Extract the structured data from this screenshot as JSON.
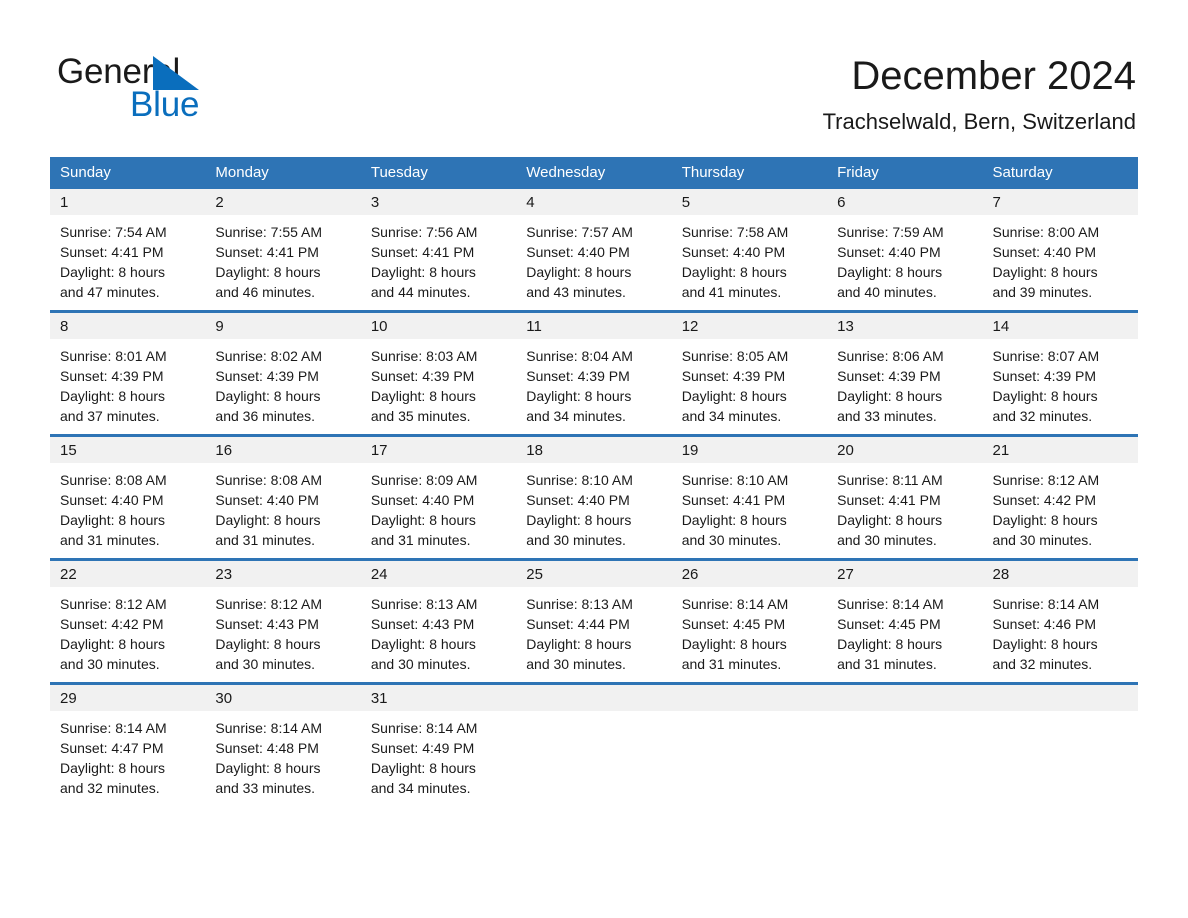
{
  "brand": {
    "word1": "General",
    "word2": "Blue",
    "triangle_color": "#0a6ebd",
    "text_color": "#1a1a1a",
    "icon": "triangle-logo-icon"
  },
  "header": {
    "month_title": "December 2024",
    "location": "Trachselwald, Bern, Switzerland"
  },
  "theme": {
    "header_blue": "#2e74b5",
    "day_band_gray": "#f1f1f1",
    "text": "#1a1a1a",
    "page_background": "#ffffff"
  },
  "weekdays": [
    "Sunday",
    "Monday",
    "Tuesday",
    "Wednesday",
    "Thursday",
    "Friday",
    "Saturday"
  ],
  "weeks": [
    [
      {
        "day": "1",
        "sunrise": "Sunrise: 7:54 AM",
        "sunset": "Sunset: 4:41 PM",
        "daylight1": "Daylight: 8 hours",
        "daylight2": "and 47 minutes."
      },
      {
        "day": "2",
        "sunrise": "Sunrise: 7:55 AM",
        "sunset": "Sunset: 4:41 PM",
        "daylight1": "Daylight: 8 hours",
        "daylight2": "and 46 minutes."
      },
      {
        "day": "3",
        "sunrise": "Sunrise: 7:56 AM",
        "sunset": "Sunset: 4:41 PM",
        "daylight1": "Daylight: 8 hours",
        "daylight2": "and 44 minutes."
      },
      {
        "day": "4",
        "sunrise": "Sunrise: 7:57 AM",
        "sunset": "Sunset: 4:40 PM",
        "daylight1": "Daylight: 8 hours",
        "daylight2": "and 43 minutes."
      },
      {
        "day": "5",
        "sunrise": "Sunrise: 7:58 AM",
        "sunset": "Sunset: 4:40 PM",
        "daylight1": "Daylight: 8 hours",
        "daylight2": "and 41 minutes."
      },
      {
        "day": "6",
        "sunrise": "Sunrise: 7:59 AM",
        "sunset": "Sunset: 4:40 PM",
        "daylight1": "Daylight: 8 hours",
        "daylight2": "and 40 minutes."
      },
      {
        "day": "7",
        "sunrise": "Sunrise: 8:00 AM",
        "sunset": "Sunset: 4:40 PM",
        "daylight1": "Daylight: 8 hours",
        "daylight2": "and 39 minutes."
      }
    ],
    [
      {
        "day": "8",
        "sunrise": "Sunrise: 8:01 AM",
        "sunset": "Sunset: 4:39 PM",
        "daylight1": "Daylight: 8 hours",
        "daylight2": "and 37 minutes."
      },
      {
        "day": "9",
        "sunrise": "Sunrise: 8:02 AM",
        "sunset": "Sunset: 4:39 PM",
        "daylight1": "Daylight: 8 hours",
        "daylight2": "and 36 minutes."
      },
      {
        "day": "10",
        "sunrise": "Sunrise: 8:03 AM",
        "sunset": "Sunset: 4:39 PM",
        "daylight1": "Daylight: 8 hours",
        "daylight2": "and 35 minutes."
      },
      {
        "day": "11",
        "sunrise": "Sunrise: 8:04 AM",
        "sunset": "Sunset: 4:39 PM",
        "daylight1": "Daylight: 8 hours",
        "daylight2": "and 34 minutes."
      },
      {
        "day": "12",
        "sunrise": "Sunrise: 8:05 AM",
        "sunset": "Sunset: 4:39 PM",
        "daylight1": "Daylight: 8 hours",
        "daylight2": "and 34 minutes."
      },
      {
        "day": "13",
        "sunrise": "Sunrise: 8:06 AM",
        "sunset": "Sunset: 4:39 PM",
        "daylight1": "Daylight: 8 hours",
        "daylight2": "and 33 minutes."
      },
      {
        "day": "14",
        "sunrise": "Sunrise: 8:07 AM",
        "sunset": "Sunset: 4:39 PM",
        "daylight1": "Daylight: 8 hours",
        "daylight2": "and 32 minutes."
      }
    ],
    [
      {
        "day": "15",
        "sunrise": "Sunrise: 8:08 AM",
        "sunset": "Sunset: 4:40 PM",
        "daylight1": "Daylight: 8 hours",
        "daylight2": "and 31 minutes."
      },
      {
        "day": "16",
        "sunrise": "Sunrise: 8:08 AM",
        "sunset": "Sunset: 4:40 PM",
        "daylight1": "Daylight: 8 hours",
        "daylight2": "and 31 minutes."
      },
      {
        "day": "17",
        "sunrise": "Sunrise: 8:09 AM",
        "sunset": "Sunset: 4:40 PM",
        "daylight1": "Daylight: 8 hours",
        "daylight2": "and 31 minutes."
      },
      {
        "day": "18",
        "sunrise": "Sunrise: 8:10 AM",
        "sunset": "Sunset: 4:40 PM",
        "daylight1": "Daylight: 8 hours",
        "daylight2": "and 30 minutes."
      },
      {
        "day": "19",
        "sunrise": "Sunrise: 8:10 AM",
        "sunset": "Sunset: 4:41 PM",
        "daylight1": "Daylight: 8 hours",
        "daylight2": "and 30 minutes."
      },
      {
        "day": "20",
        "sunrise": "Sunrise: 8:11 AM",
        "sunset": "Sunset: 4:41 PM",
        "daylight1": "Daylight: 8 hours",
        "daylight2": "and 30 minutes."
      },
      {
        "day": "21",
        "sunrise": "Sunrise: 8:12 AM",
        "sunset": "Sunset: 4:42 PM",
        "daylight1": "Daylight: 8 hours",
        "daylight2": "and 30 minutes."
      }
    ],
    [
      {
        "day": "22",
        "sunrise": "Sunrise: 8:12 AM",
        "sunset": "Sunset: 4:42 PM",
        "daylight1": "Daylight: 8 hours",
        "daylight2": "and 30 minutes."
      },
      {
        "day": "23",
        "sunrise": "Sunrise: 8:12 AM",
        "sunset": "Sunset: 4:43 PM",
        "daylight1": "Daylight: 8 hours",
        "daylight2": "and 30 minutes."
      },
      {
        "day": "24",
        "sunrise": "Sunrise: 8:13 AM",
        "sunset": "Sunset: 4:43 PM",
        "daylight1": "Daylight: 8 hours",
        "daylight2": "and 30 minutes."
      },
      {
        "day": "25",
        "sunrise": "Sunrise: 8:13 AM",
        "sunset": "Sunset: 4:44 PM",
        "daylight1": "Daylight: 8 hours",
        "daylight2": "and 30 minutes."
      },
      {
        "day": "26",
        "sunrise": "Sunrise: 8:14 AM",
        "sunset": "Sunset: 4:45 PM",
        "daylight1": "Daylight: 8 hours",
        "daylight2": "and 31 minutes."
      },
      {
        "day": "27",
        "sunrise": "Sunrise: 8:14 AM",
        "sunset": "Sunset: 4:45 PM",
        "daylight1": "Daylight: 8 hours",
        "daylight2": "and 31 minutes."
      },
      {
        "day": "28",
        "sunrise": "Sunrise: 8:14 AM",
        "sunset": "Sunset: 4:46 PM",
        "daylight1": "Daylight: 8 hours",
        "daylight2": "and 32 minutes."
      }
    ],
    [
      {
        "day": "29",
        "sunrise": "Sunrise: 8:14 AM",
        "sunset": "Sunset: 4:47 PM",
        "daylight1": "Daylight: 8 hours",
        "daylight2": "and 32 minutes."
      },
      {
        "day": "30",
        "sunrise": "Sunrise: 8:14 AM",
        "sunset": "Sunset: 4:48 PM",
        "daylight1": "Daylight: 8 hours",
        "daylight2": "and 33 minutes."
      },
      {
        "day": "31",
        "sunrise": "Sunrise: 8:14 AM",
        "sunset": "Sunset: 4:49 PM",
        "daylight1": "Daylight: 8 hours",
        "daylight2": "and 34 minutes."
      },
      {
        "day": "",
        "sunrise": "",
        "sunset": "",
        "daylight1": "",
        "daylight2": ""
      },
      {
        "day": "",
        "sunrise": "",
        "sunset": "",
        "daylight1": "",
        "daylight2": ""
      },
      {
        "day": "",
        "sunrise": "",
        "sunset": "",
        "daylight1": "",
        "daylight2": ""
      },
      {
        "day": "",
        "sunrise": "",
        "sunset": "",
        "daylight1": "",
        "daylight2": ""
      }
    ]
  ]
}
